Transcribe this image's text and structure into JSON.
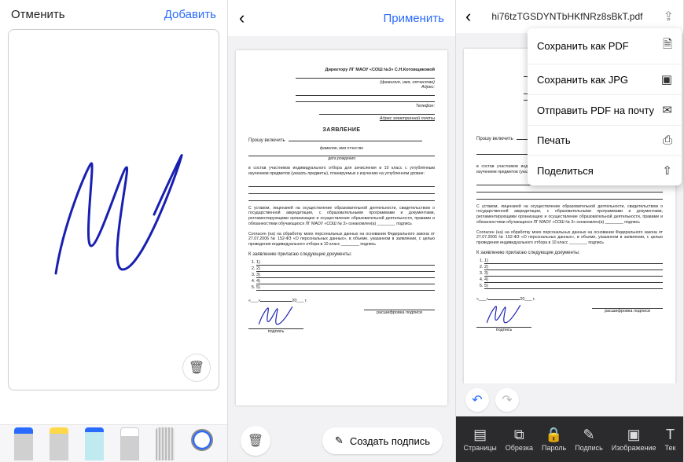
{
  "panel1": {
    "cancel": "Отменить",
    "add": "Добавить",
    "tools": {
      "pen": "pen",
      "highlighter": "highlighter",
      "marker": "marker",
      "eraser": "eraser",
      "ruler": "ruler",
      "color": "color"
    }
  },
  "panel2": {
    "apply": "Применить",
    "create_signature": "Создать подпись"
  },
  "panel3": {
    "filename": "hi76tzTGSDYNTbHKfNRz8sBkT.pdf",
    "menu": {
      "save_pdf": "Сохранить как PDF",
      "save_jpg": "Сохранить как JPG",
      "send_pdf": "Отправить PDF на почту",
      "print": "Печать",
      "share": "Поделиться"
    },
    "bottom": {
      "pages": "Страницы",
      "crop": "Обрезка",
      "password": "Пароль",
      "sign": "Подпись",
      "image": "Изображение",
      "text": "Тек"
    }
  },
  "doc": {
    "header_to": "Директору   ЛГ   МАОУ   «СОШ   №3» С.Н.Котовщиковой",
    "lbl_fio_placeholder": "(фамилия, имя, отчество)",
    "lbl_address": "Адрес:",
    "lbl_phone": "Телефон:",
    "lbl_email": "Адрес электронной почты",
    "title": "ЗАЯВЛЕНИЕ",
    "line_include": "Прошу включить",
    "fio_caption": "фамилия, имя отчество",
    "dob_caption": "дата рождения",
    "para1": "в состав участников индивидуального отбора для зачисления в 10 класс с углублённым изучением предметов (указать предметы), планируемых к изучению на углубленном уровне:",
    "para2": "С уставом, лицензией на осуществление образовательной деятельности, свидетельством о государственной аккредитации, с образовательными программами и документами, регламентирующими организацию и осуществление образовательной деятельности, правами и обязанностями обучающихся ЛГ МАОУ «СОШ № 3» ознакомлен(а) ________ подпись",
    "para3": "Согласен (на) на обработку моих персональных данных на основании Федерального закона от 27.07.2006 № 152-ФЗ «О персональных данных», в объеме, указанном в заявлении, с целью проведения индивидуального отбора в 10 класс ________ подпись",
    "attach": "К заявлению прилагаю следующие документы:",
    "date_fmt_left": "«___»",
    "date_fmt_mid": "20___ г.",
    "sig_caption_left": "подпись",
    "sig_caption_right": "расшифровка подписи"
  }
}
